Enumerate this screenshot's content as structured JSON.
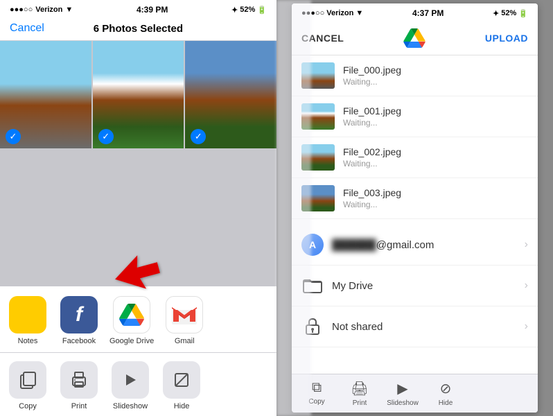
{
  "left_phone": {
    "status_bar": {
      "carrier": "Verizon",
      "time": "4:39 PM",
      "battery": "52%"
    },
    "nav": {
      "cancel": "Cancel",
      "title": "6 Photos Selected"
    },
    "photos": [
      {
        "id": "p1",
        "class": "sky-building",
        "checked": true
      },
      {
        "id": "p2",
        "class": "building-bright",
        "checked": true
      },
      {
        "id": "p3",
        "class": "building-right",
        "checked": true
      }
    ],
    "share_apps": [
      {
        "id": "notes",
        "label": "Notes"
      },
      {
        "id": "facebook",
        "label": "Facebook"
      },
      {
        "id": "gdrive",
        "label": "Google Drive"
      },
      {
        "id": "gmail",
        "label": "Gmail"
      }
    ],
    "share_actions": [
      {
        "id": "copy",
        "label": "Copy",
        "icon": "⧉"
      },
      {
        "id": "print",
        "label": "Print",
        "icon": "🖨"
      },
      {
        "id": "slideshow",
        "label": "Slideshow",
        "icon": "▶"
      },
      {
        "id": "hide",
        "label": "Hide",
        "icon": "⊘"
      }
    ]
  },
  "right_phone": {
    "status_bar": {
      "carrier": "Verizon",
      "time": "4:37 PM",
      "battery": "52%"
    },
    "upload_nav": {
      "cancel": "CANCEL",
      "upload": "UPLOAD"
    },
    "files": [
      {
        "name": "File_000.jpeg",
        "status": "Waiting..."
      },
      {
        "name": "File_001.jpeg",
        "status": "Waiting..."
      },
      {
        "name": "File_002.jpeg",
        "status": "Waiting..."
      },
      {
        "name": "File_003.jpeg",
        "status": "Waiting..."
      }
    ],
    "account": {
      "email_suffix": "@gmail.com"
    },
    "destinations": [
      {
        "label": "My Drive"
      },
      {
        "label": "Not shared"
      }
    ],
    "bottom_actions": [
      {
        "label": "Copy"
      },
      {
        "label": "Print"
      },
      {
        "label": "Slideshow"
      },
      {
        "label": "Hide"
      }
    ]
  }
}
